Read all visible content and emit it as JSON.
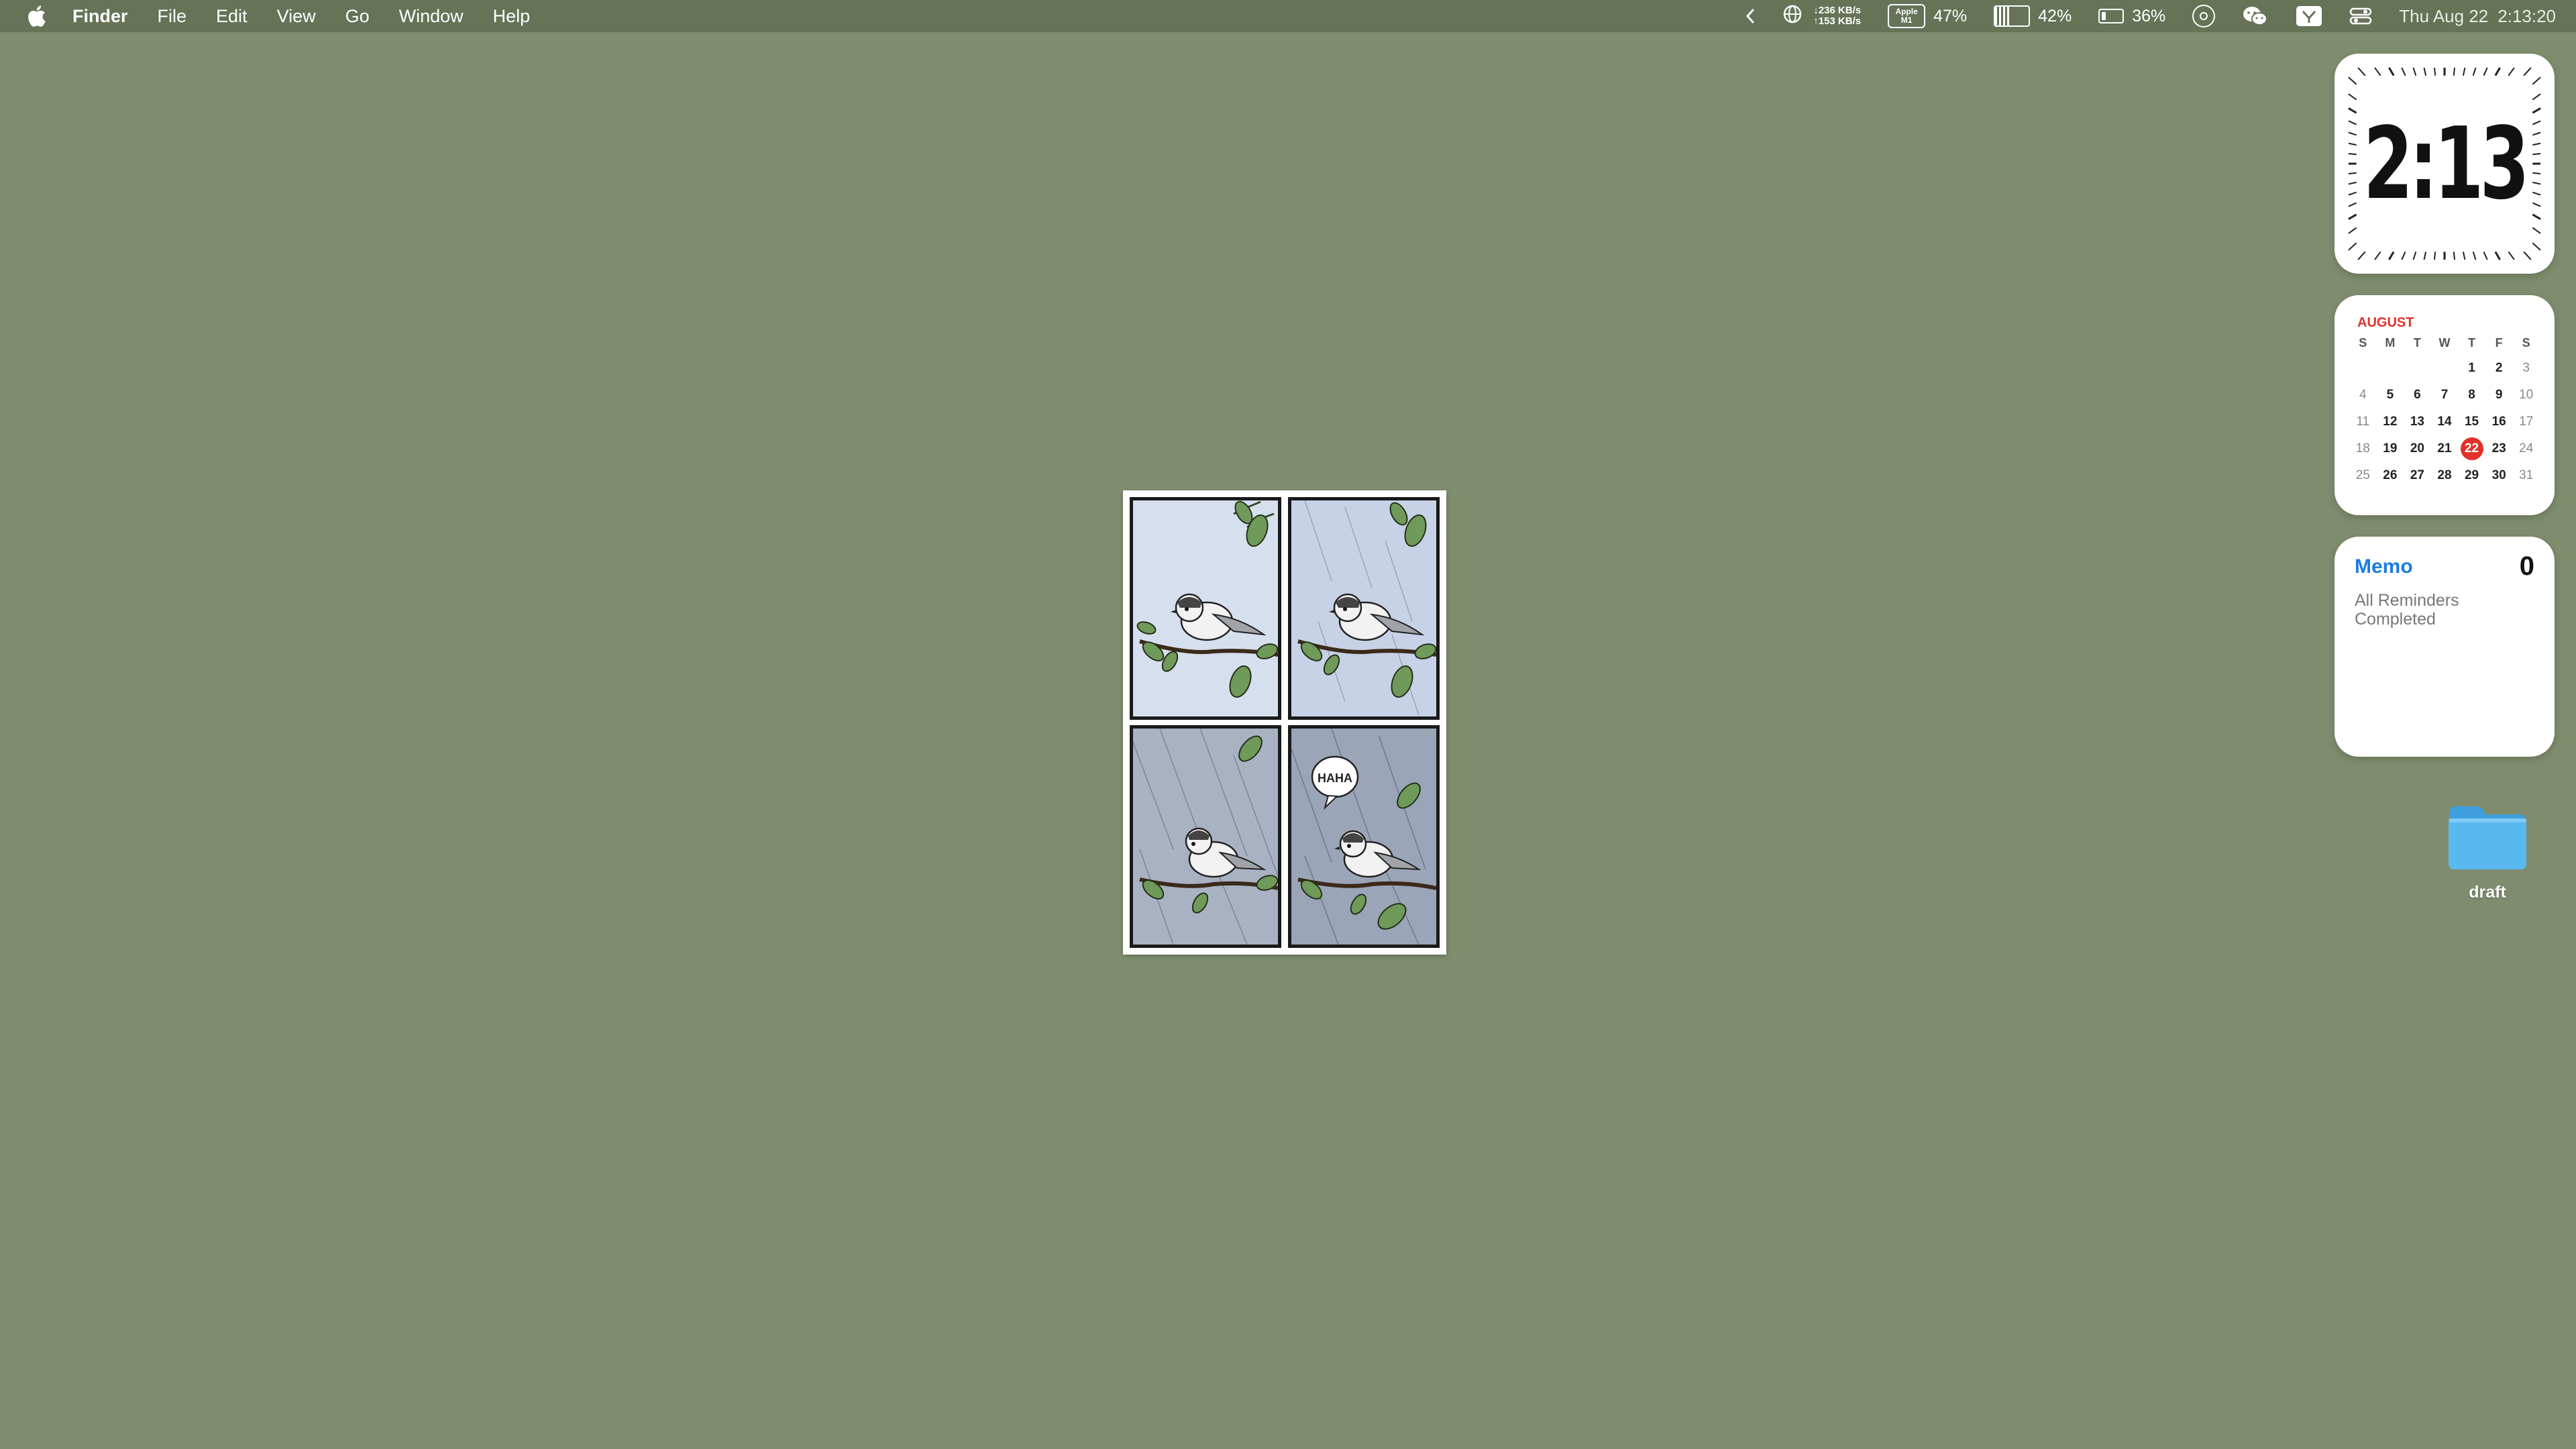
{
  "menubar": {
    "apple_icon": "apple-logo-icon",
    "app_name": "Finder",
    "menus": [
      "File",
      "Edit",
      "View",
      "Go",
      "Window",
      "Help"
    ],
    "status": {
      "collapse_icon": "chevron-left-icon",
      "net_download": "↓236 KB/s",
      "net_upload": "↑153 KB/s",
      "chip_line1": "Apple",
      "chip_line2": "M1",
      "cpu_percent": "47%",
      "memory_percent": "42%",
      "memory_fill": 0.42,
      "battery_percent": "36%",
      "battery_fill": 0.36,
      "date": "Thu Aug 22",
      "time": "2:13:20"
    }
  },
  "widgets": {
    "clock": {
      "time": "2:13"
    },
    "calendar": {
      "month": "AUGUST",
      "day_headers": [
        "S",
        "M",
        "T",
        "W",
        "T",
        "F",
        "S"
      ],
      "weeks": [
        [
          "",
          "",
          "",
          "",
          "1",
          "2",
          "3"
        ],
        [
          "4",
          "5",
          "6",
          "7",
          "8",
          "9",
          "10"
        ],
        [
          "11",
          "12",
          "13",
          "14",
          "15",
          "16",
          "17"
        ],
        [
          "18",
          "19",
          "20",
          "21",
          "22",
          "23",
          "24"
        ],
        [
          "25",
          "26",
          "27",
          "28",
          "29",
          "30",
          "31"
        ]
      ],
      "today": "22",
      "accent_color": "#e0312a"
    },
    "memo": {
      "title": "Memo",
      "count": "0",
      "subtitle": "All Reminders Completed"
    }
  },
  "comic": {
    "speech_text": "HAHA"
  },
  "desktop": {
    "folder_label": "draft"
  },
  "colors": {
    "desktop_bg": "#7f8d6e",
    "menubar_bg": "#667357",
    "folder_blue": "#5ab8f0"
  }
}
